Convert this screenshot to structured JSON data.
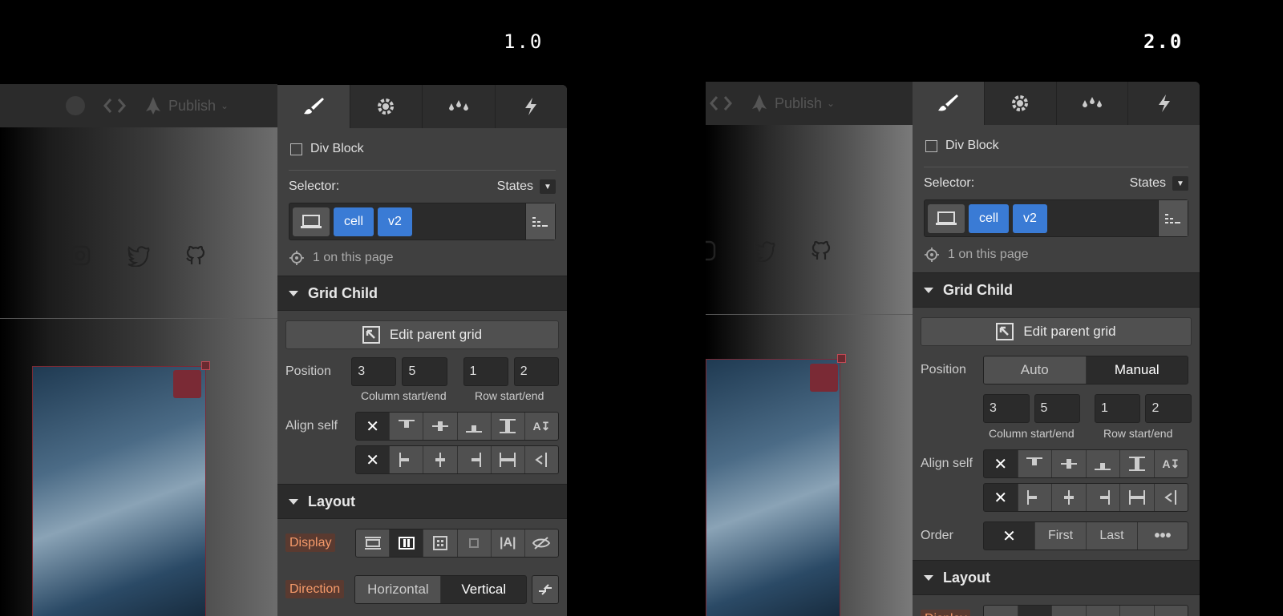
{
  "versions": {
    "v1": "1.0",
    "v2": "2.0"
  },
  "topbar": {
    "publish_label": "Publish"
  },
  "panel": {
    "element_name": "Div Block",
    "selector_label": "Selector:",
    "states_label": "States",
    "classes": [
      "cell",
      "v2"
    ],
    "on_page": "1 on this page",
    "grid_child_title": "Grid Child",
    "edit_parent_grid": "Edit parent grid",
    "position_label": "Position",
    "position_modes": [
      "Auto",
      "Manual"
    ],
    "column_start": "3",
    "column_end": "5",
    "row_start": "1",
    "row_end": "2",
    "column_caption": "Column start/end",
    "row_caption": "Row start/end",
    "align_self_label": "Align self",
    "order_label": "Order",
    "order_options": [
      "First",
      "Last"
    ],
    "layout_title": "Layout",
    "display_label": "Display",
    "direction_label": "Direction",
    "direction_options": [
      "Horizontal",
      "Vertical"
    ]
  },
  "colors": {
    "accent": "#3a7bd5",
    "panel_bg": "#404040",
    "header_bg": "#2b2b2b",
    "highlight_text": "#f59a6a"
  }
}
